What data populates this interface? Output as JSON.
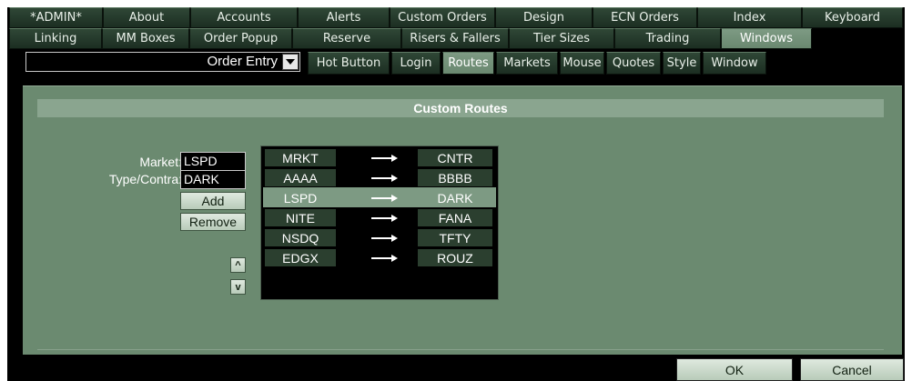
{
  "tabs_row1": [
    "*ADMIN*",
    "About",
    "Accounts",
    "Alerts",
    "Custom Orders",
    "Design",
    "ECN Orders",
    "Index",
    "Keyboard"
  ],
  "tabs_row2": [
    "Linking",
    "MM Boxes",
    "Order Popup",
    "Reserve",
    "Risers & Fallers",
    "Tier Sizes",
    "Trading",
    "Windows"
  ],
  "active_tab_row2": "Windows",
  "window_select": {
    "value": "Order Entry"
  },
  "subtabs": [
    "Hot Button",
    "Login",
    "Routes",
    "Markets",
    "Mouse",
    "Quotes",
    "Style",
    "Window"
  ],
  "active_subtab": "Routes",
  "panel": {
    "title": "Custom Routes",
    "market_label": "Market:",
    "market_value": "LSPD",
    "type_label": "Type/Contra:",
    "type_value": "DARK",
    "add_label": "Add",
    "remove_label": "Remove",
    "up_label": "^",
    "down_label": "v"
  },
  "routes": [
    {
      "market": "MRKT",
      "target": "CNTR",
      "selected": false
    },
    {
      "market": "AAAA",
      "target": "BBBB",
      "selected": false
    },
    {
      "market": "LSPD",
      "target": "DARK",
      "selected": true
    },
    {
      "market": "NITE",
      "target": "FANA",
      "selected": false
    },
    {
      "market": "NSDQ",
      "target": "TFTY",
      "selected": false
    },
    {
      "market": "EDGX",
      "target": "ROUZ",
      "selected": false
    }
  ],
  "footer": {
    "ok_label": "OK",
    "cancel_label": "Cancel"
  },
  "colors": {
    "tab_dark": "#2f4736",
    "tab_active": "#7d9a83",
    "panel_bg": "#6b8a70",
    "header_bg": "#8aa58f"
  },
  "icons": {
    "route_arrow": "right-arrow-icon",
    "dropdown": "chevron-down-icon"
  }
}
